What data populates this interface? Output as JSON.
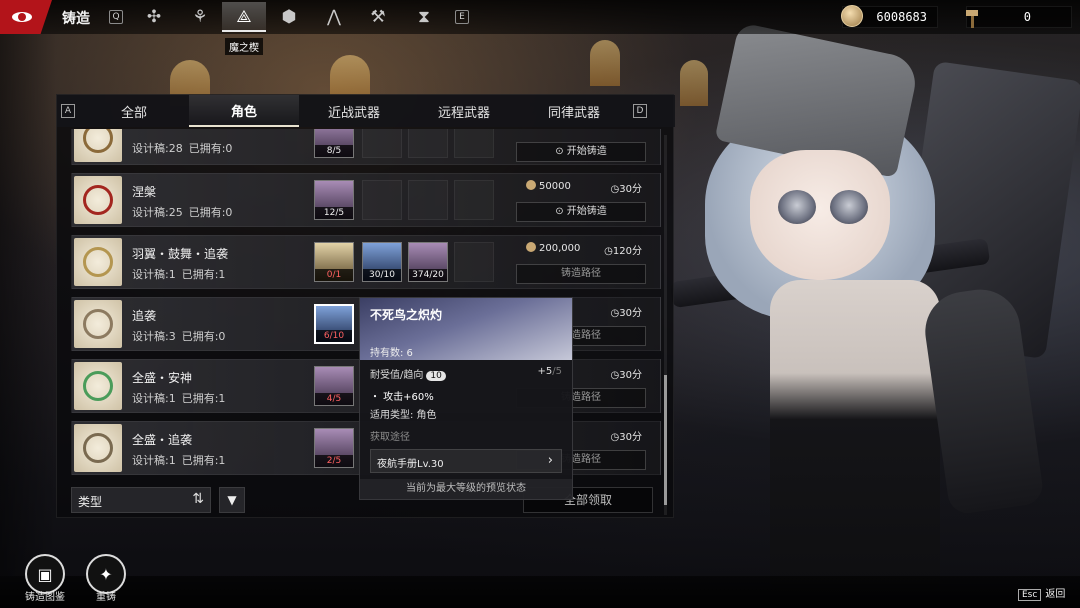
{
  "top": {
    "title": "铸造",
    "key_left": "Q",
    "key_right": "E",
    "tabs": [
      {
        "icon": "shuriken-icon",
        "glyph": "✣"
      },
      {
        "icon": "trident-icon",
        "glyph": "⚘"
      },
      {
        "icon": "triangle-knot-icon",
        "glyph": "⟁",
        "active": true
      },
      {
        "icon": "cube-icon",
        "glyph": "⬢"
      },
      {
        "icon": "compass-icon",
        "glyph": "⋀"
      },
      {
        "icon": "hammer-cross-icon",
        "glyph": "⚒"
      },
      {
        "icon": "hourglass-icon",
        "glyph": "⧗"
      }
    ],
    "active_tooltip": "魔之楔",
    "currency": [
      {
        "icon": "coin-icon",
        "value": "6008683"
      },
      {
        "icon": "hammer-icon",
        "value": "0"
      }
    ]
  },
  "categories": {
    "key_left": "A",
    "key_right": "D",
    "items": [
      "全部",
      "角色",
      "近战武器",
      "远程武器",
      "同律武器"
    ],
    "active": "角色"
  },
  "rows": [
    {
      "name": "",
      "design": "设计稿:28",
      "owned": "已拥有:0",
      "mats": [
        {
          "type": "purple",
          "count": "8/5",
          "short": false
        }
      ],
      "price": "50000",
      "time": "",
      "button": "开始铸造"
    },
    {
      "name": "涅槃",
      "design": "设计稿:25",
      "owned": "已拥有:0",
      "mats": [
        {
          "type": "purple",
          "count": "12/5",
          "short": false
        }
      ],
      "price": "50000",
      "time": "30分",
      "button": "开始铸造"
    },
    {
      "name": "羽翼・鼓舞・追袭",
      "design": "设计稿:1",
      "owned": "已拥有:1",
      "mats": [
        {
          "type": "gold",
          "count": "0/1",
          "short": true
        },
        {
          "type": "blue",
          "count": "30/10",
          "short": false
        },
        {
          "type": "purple",
          "count": "374/20",
          "short": false
        }
      ],
      "price": "200,000",
      "time": "120分",
      "button": "铸造路径"
    },
    {
      "name": "追袭",
      "design": "设计稿:3",
      "owned": "已拥有:0",
      "mats": [
        {
          "type": "blue",
          "count": "6/10",
          "short": true
        }
      ],
      "price": "",
      "time": "30分",
      "button": "铸造路径"
    },
    {
      "name": "全盛・安神",
      "design": "设计稿:1",
      "owned": "已拥有:1",
      "mats": [
        {
          "type": "purple",
          "count": "4/5",
          "short": true
        }
      ],
      "price": "",
      "time": "30分",
      "button": "铸造路径"
    },
    {
      "name": "全盛・追袭",
      "design": "设计稿:1",
      "owned": "已拥有:1",
      "mats": [
        {
          "type": "purple",
          "count": "2/5",
          "short": true
        }
      ],
      "price": "",
      "time": "30分",
      "button": "铸造路径"
    }
  ],
  "footer": {
    "type_label": "类型",
    "claim_all": "全部领取"
  },
  "tooltip": {
    "title": "不死鸟之炽灼",
    "owned": "持有数: 6",
    "tolerance_label": "耐受值/趋向",
    "tolerance_level": "10",
    "tolerance_value": "+5",
    "tolerance_max": "/5",
    "effect": "・ 攻击+60%",
    "applies": "适用类型: 角色",
    "source_label": "获取途径",
    "source": "夜航手册Lv.30",
    "footer": "当前为最大等级的预览状态"
  },
  "bottom": {
    "btn1": "铸造图鉴",
    "btn2": "重铸",
    "esc_key": "Esc",
    "esc_label": "返回"
  }
}
